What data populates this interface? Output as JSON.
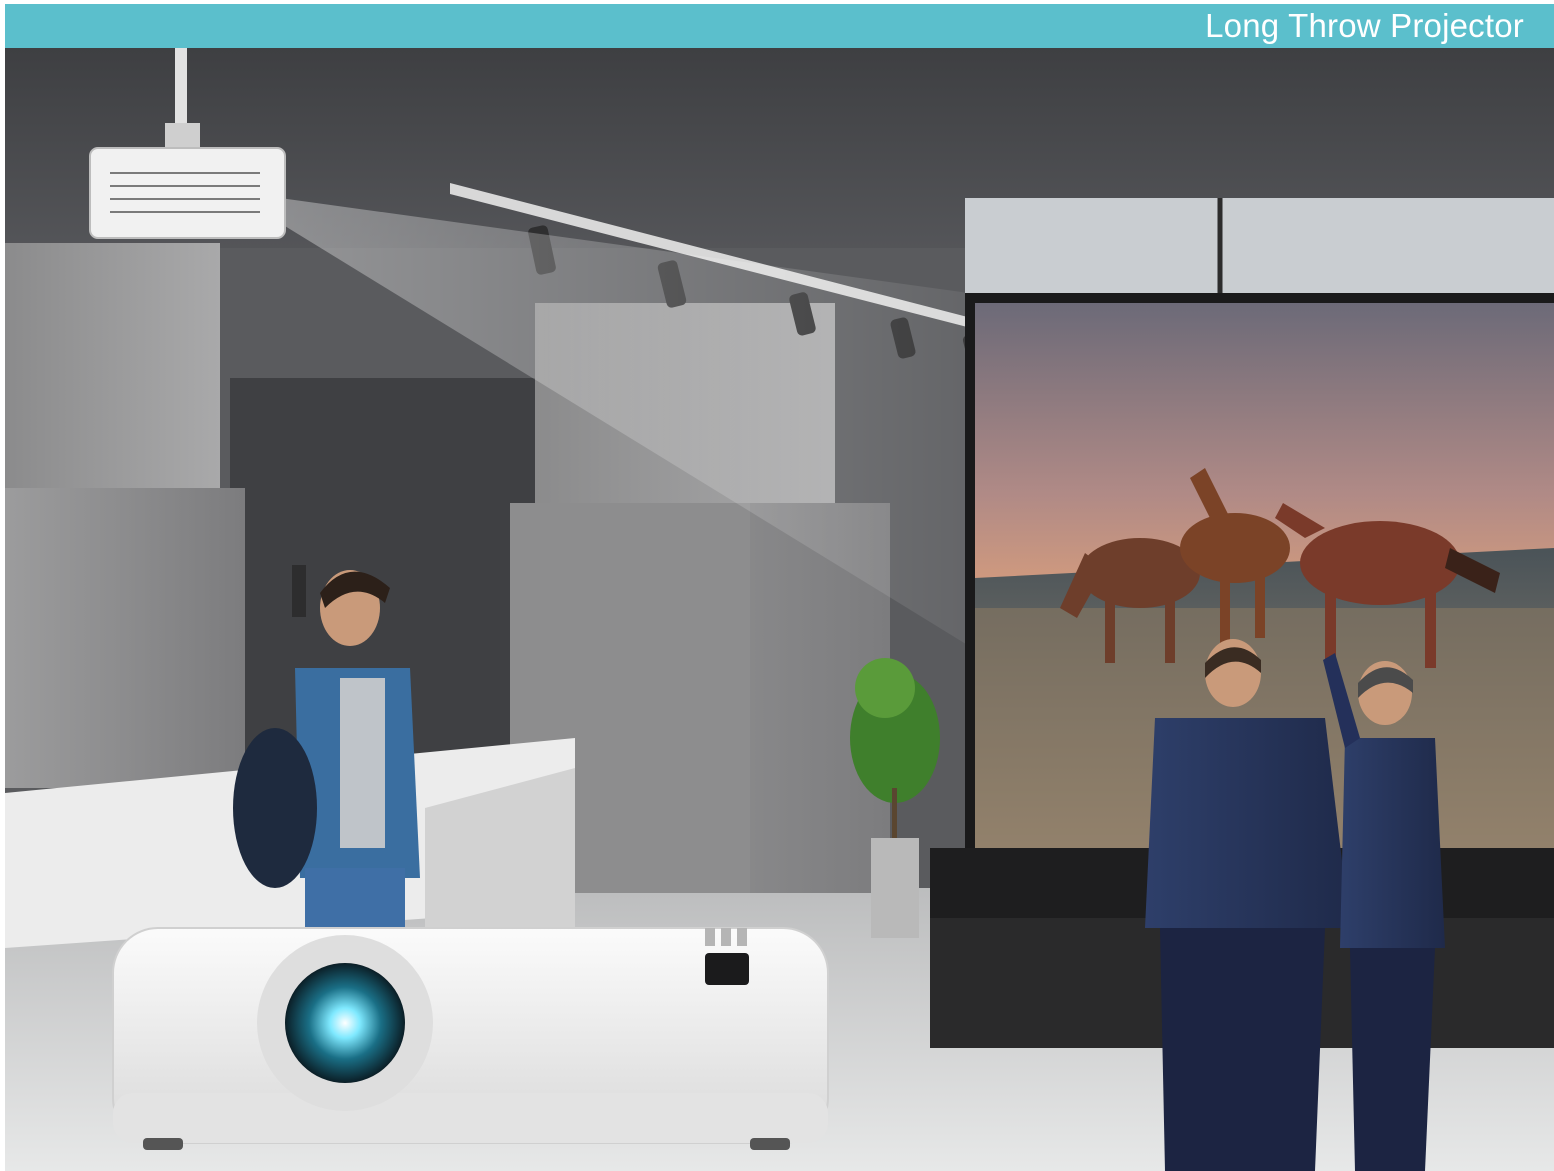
{
  "header": {
    "title": "Long Throw Projector"
  },
  "colors": {
    "header_bar": "#5bbfcc",
    "header_text": "#ffffff"
  },
  "scene": {
    "icons": [
      "ceiling-projector-icon",
      "floor-projector-icon",
      "projection-screen-icon",
      "horse-icon",
      "person-icon",
      "plant-icon",
      "track-light-icon"
    ]
  }
}
